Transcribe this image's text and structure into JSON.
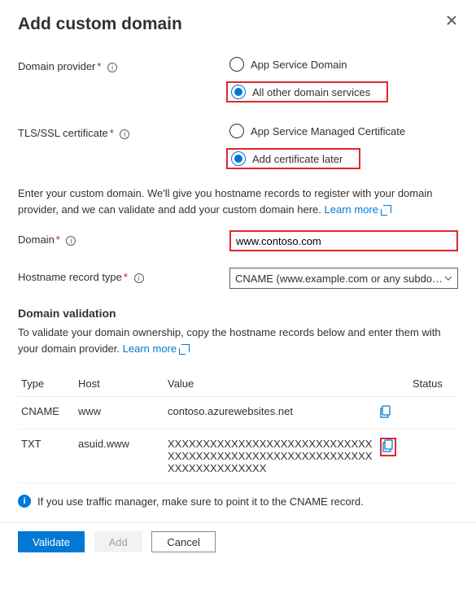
{
  "title": "Add custom domain",
  "fields": {
    "domainProvider": {
      "label": "Domain provider",
      "options": [
        "App Service Domain",
        "All other domain services"
      ],
      "selected": 1
    },
    "tlsCert": {
      "label": "TLS/SSL certificate",
      "options": [
        "App Service Managed Certificate",
        "Add certificate later"
      ],
      "selected": 1
    },
    "description": "Enter your custom domain. We'll give you hostname records to register with your domain provider, and we can validate and add your custom domain here.",
    "learnMore": "Learn more",
    "domain": {
      "label": "Domain",
      "value": "www.contoso.com"
    },
    "hostnameType": {
      "label": "Hostname record type",
      "value": "CNAME (www.example.com or any subdo…"
    }
  },
  "validation": {
    "title": "Domain validation",
    "desc": "To validate your domain ownership, copy the hostname records below and enter them with your domain provider.",
    "learnMore": "Learn more",
    "headers": [
      "Type",
      "Host",
      "Value",
      "Status"
    ],
    "rows": [
      {
        "type": "CNAME",
        "host": "www",
        "value": "contoso.azurewebsites.net",
        "copyHighlight": false
      },
      {
        "type": "TXT",
        "host": "asuid.www",
        "value": "XXXXXXXXXXXXXXXXXXXXXXXXXXXXXXXXXXXXXXXXXXXXXXXXXXXXXXXXXXXXXXXXXXXXXXXX",
        "copyHighlight": true
      }
    ]
  },
  "note": "If you use traffic manager, make sure to point it to the CNAME record.",
  "buttons": {
    "validate": "Validate",
    "add": "Add",
    "cancel": "Cancel"
  }
}
